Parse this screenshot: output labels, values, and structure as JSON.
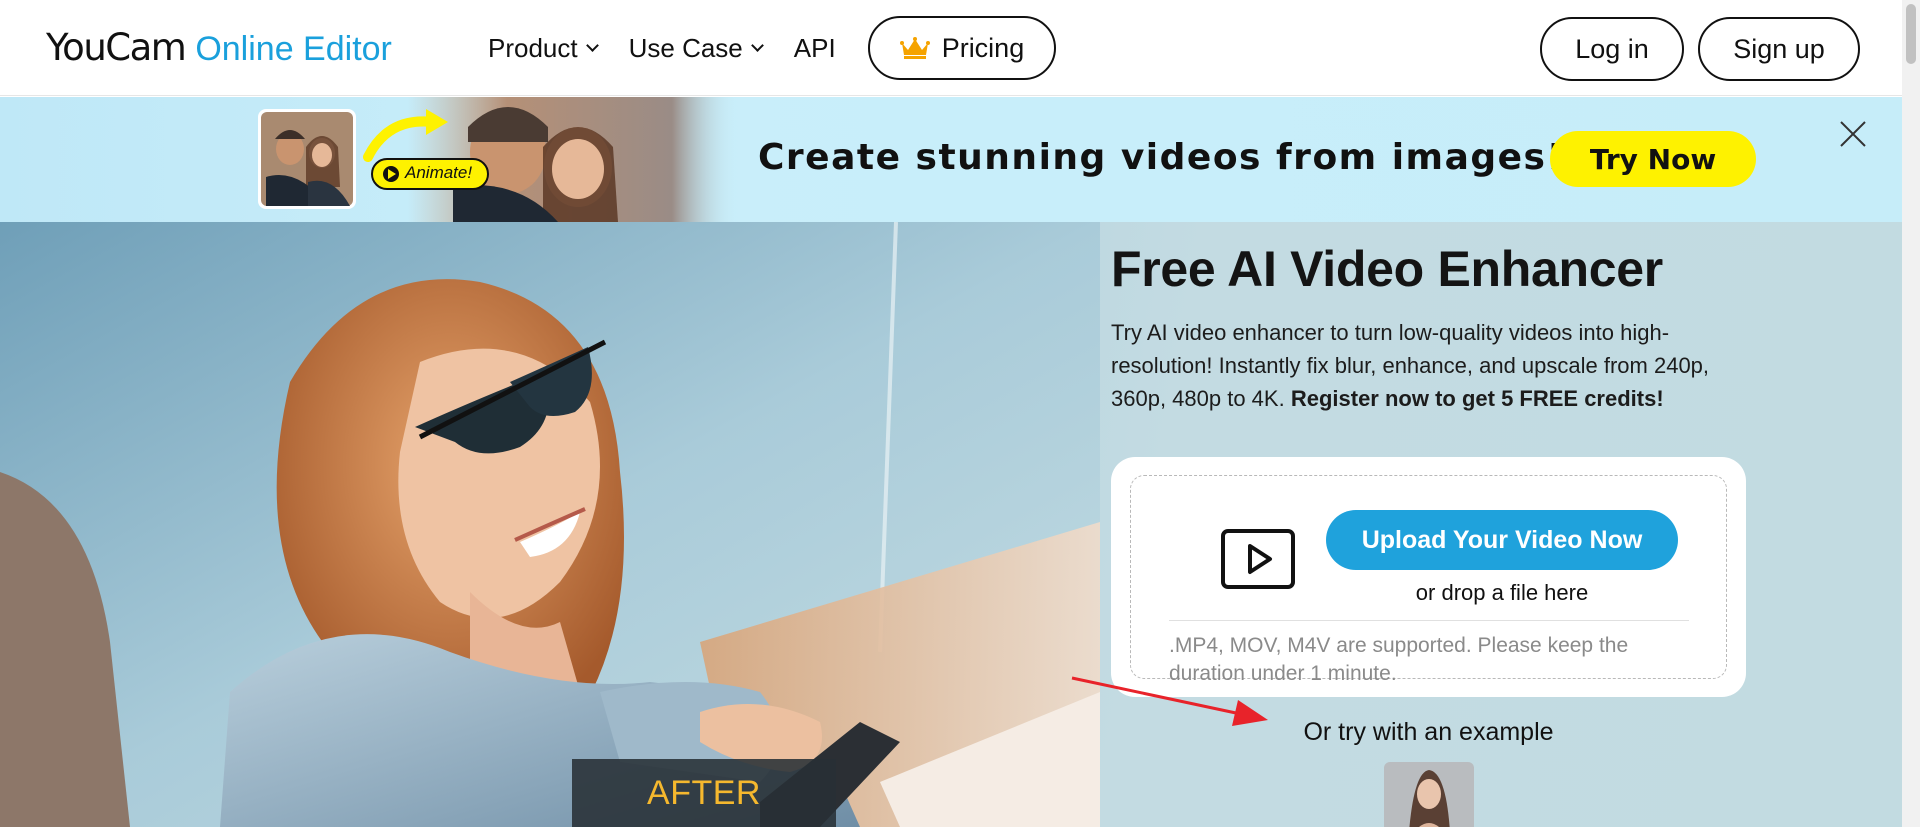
{
  "nav": {
    "logo_main": "YouCam",
    "logo_sub": "Online Editor",
    "items": [
      {
        "label": "Product",
        "has_dropdown": true
      },
      {
        "label": "Use Case",
        "has_dropdown": true
      },
      {
        "label": "API",
        "has_dropdown": false
      }
    ],
    "pricing_label": "Pricing",
    "pricing_icon": "crown-icon",
    "login_label": "Log in",
    "signup_label": "Sign up"
  },
  "banner": {
    "badge_label": "Animate!",
    "headline": "Create stunning videos from images!",
    "cta_label": "Try Now",
    "cta_color": "#fef200",
    "close_icon": "close-icon"
  },
  "hero": {
    "after_label": "AFTER",
    "title": "Free AI Video Enhancer",
    "description": " Try AI video enhancer to turn low-quality videos into high-resolution! Instantly fix blur, enhance, and upscale from 240p, 360p, 480p to 4K. ",
    "description_bold": "Register now to get 5 FREE credits!",
    "upload": {
      "button_label": "Upload Your Video Now",
      "button_color": "#1fa2dc",
      "drop_text": "or drop a file here",
      "support_text": ".MP4, MOV, M4V are supported. Please keep the duration under 1 minute.",
      "icon": "play-icon"
    },
    "example_title": "Or try with an example"
  },
  "colors": {
    "brand_blue": "#1aa0dc",
    "banner_bg": "#c6edf9",
    "annotation_arrow": "#e8232a"
  }
}
